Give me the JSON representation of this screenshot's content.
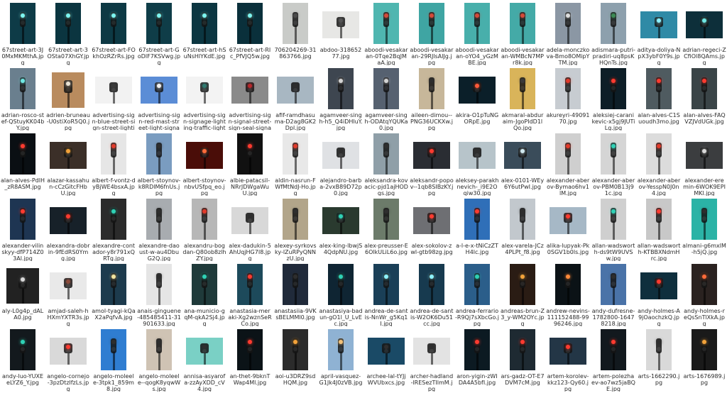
{
  "files": [
    {
      "name": "67street-art-3J0MxMKMthA.jpg",
      "bg": "#0e3b47",
      "lamp": "#7df5f0",
      "shape": "portrait"
    },
    {
      "name": "67street-art-3OSta07XhGY.jpg",
      "bg": "#0b3540",
      "lamp": "#7df5f0",
      "shape": "portrait"
    },
    {
      "name": "67street-art-FOkhOzRZrRs.jpg",
      "bg": "#0d3944",
      "lamp": "#7df5f0",
      "shape": "portrait"
    },
    {
      "name": "67street-art-GoDlF7KSVwg.jpg",
      "bg": "#0f3d48",
      "lamp": "#7df5f0",
      "shape": "portrait"
    },
    {
      "name": "67street-art-hSuNsHlYKdE.jpg",
      "bg": "#0c3641",
      "lamp": "#7df5f0",
      "shape": "portrait"
    },
    {
      "name": "67street-art-RIc_PfVJQ5w.jpg",
      "bg": "#0a303b",
      "lamp": "#7df5f0",
      "shape": "portrait"
    },
    {
      "name": "706204269-31863766.jpg",
      "bg": "#c9cbc8",
      "lamp": "#4a4a4a",
      "shape": "portrait"
    },
    {
      "name": "abdoo-31865277.jpg",
      "bg": "#e7e7e5",
      "lamp": "#555555",
      "shape": "landscape"
    },
    {
      "name": "aboodi-vesakaran-0Tqe2BqJMaA.jpg",
      "bg": "#4fb6b0",
      "lamp": "#d34a3a",
      "shape": "portrait"
    },
    {
      "name": "aboodi-vesakaran-29RJlsAlJg.jpg",
      "bg": "#3fa5a3",
      "lamp": "#d34a3a",
      "shape": "portrait"
    },
    {
      "name": "aboodi-vesakaran-oYO4_yGzMBE.jpg",
      "bg": "#48afab",
      "lamp": "#d34a3a",
      "shape": "portrait"
    },
    {
      "name": "aboodi-vesakaran-WMBcN7MPr8k.jpg",
      "bg": "#44aaa7",
      "lamp": "#d34a3a",
      "shape": "portrait"
    },
    {
      "name": "adela-monczkova-Bmo8OMipYTM.jpg",
      "bg": "#8b97a4",
      "lamp": "#dddddd",
      "shape": "portrait"
    },
    {
      "name": "adismara-putri-pradiri-uq8psKHQnTs.jpg",
      "bg": "#8da0ad",
      "lamp": "#3c8a54",
      "shape": "portrait"
    },
    {
      "name": "aditya-doliya-NpX3ybF0Y9s.jpg",
      "bg": "#2f8aa6",
      "lamp": "#8ef2ff",
      "shape": "landscape"
    },
    {
      "name": "adrian-regeci-ZCfiOl8QAms.jpg",
      "bg": "#0d2f3a",
      "lamp": "#6fe8e3",
      "shape": "landscape"
    },
    {
      "name": "adrian-rosco-stef-QStuyKK04bY.jpg",
      "bg": "#6a7f8e",
      "lamp": "#6fe8e3",
      "shape": "portrait"
    },
    {
      "name": "adrien-bruneau-U0stiXoR5Q0.jpg",
      "bg": "#b98b5e",
      "lamp": "#e9e2d4",
      "shape": "square"
    },
    {
      "name": "advertising-sign-blue-street-sign-street-lighting-102726.jpg",
      "bg": "#f2f2f2",
      "lamp": "#3a3a3a",
      "shape": "landscape"
    },
    {
      "name": "advertising-sign-red-mast-street-light-signage-742999.jpg",
      "bg": "#5b8dd6",
      "lamp": "#f2f2f2",
      "shape": "landscape"
    },
    {
      "name": "advertising-sign-signage-lighting-traffic-light-brand-100956.jpg",
      "bg": "#f3f3f3",
      "lamp": "#2f7a70",
      "shape": "landscape"
    },
    {
      "name": "advertising-sign-signal-street-sign-seal-signage-163696.jpg",
      "bg": "#8a8a8a",
      "lamp": "#b8272b",
      "shape": "landscape"
    },
    {
      "name": "afif-ramdhasuma-D2ag8GK2Dpl.jpg",
      "bg": "#a8b7c2",
      "lamp": "#2e2e2e",
      "shape": "landscape"
    },
    {
      "name": "agamveer-singh-h5_Q4iDHluY.jpg",
      "bg": "#3e4650",
      "lamp": "#d4d4d4",
      "shape": "portrait"
    },
    {
      "name": "agamveer-singh-ODAtqYQUKa0.jpg",
      "bg": "#566170",
      "lamp": "#d4d4d4",
      "shape": "portrait"
    },
    {
      "name": "aileen-dimou--PNG36UCKXw.jpg",
      "bg": "#c7b79a",
      "lamp": "#2e2e2e",
      "shape": "portrait"
    },
    {
      "name": "akira-O1pTuNGORpE.jpg",
      "bg": "#0b1f29",
      "lamp": "#ff5a3a",
      "shape": "landscape"
    },
    {
      "name": "akmaral-abduraim-JgoPIdD1lQo.jpg",
      "bg": "#d9b45a",
      "lamp": "#3a3a3a",
      "shape": "portrait"
    },
    {
      "name": "akureyri-4909170.jpg",
      "bg": "#c7ccd1",
      "lamp": "#e23a2a",
      "shape": "portrait"
    },
    {
      "name": "aleksiej-caranikevic-x5gj9JUTiLg.jpg",
      "bg": "#0d1e27",
      "lamp": "#ff3b30",
      "shape": "portrait"
    },
    {
      "name": "alan-alves-C1Suoudh3mo.jpg",
      "bg": "#4f5b60",
      "lamp": "#ff3b30",
      "shape": "portrait"
    },
    {
      "name": "alan-alves-FAQVZJVdUGk.jpg",
      "bg": "#3a4447",
      "lamp": "#ff3b30",
      "shape": "portrait"
    },
    {
      "name": "alan-alves-PdlH_zR8ASM.jpg",
      "bg": "#0a0f13",
      "lamp": "#ff3b30",
      "shape": "portrait"
    },
    {
      "name": "alazar-kassahun-cCzGitcFHbU.jpg",
      "bg": "#3b2f28",
      "lamp": "#f2a23a",
      "shape": "landscape"
    },
    {
      "name": "albert-f-vontz-dyBjWE4bsxA.jpg",
      "bg": "#e6e6e6",
      "lamp": "#e23a2a",
      "shape": "portrait"
    },
    {
      "name": "albert-stoynov-k8RDlM6fnUs.jpg",
      "bg": "#7a9cc0",
      "lamp": "#2e2e2e",
      "shape": "portrait"
    },
    {
      "name": "albert-stoynov-nbvUSfpq_eo.jpg",
      "bg": "#4a0d08",
      "lamp": "#ff6b3a",
      "shape": "landscape"
    },
    {
      "name": "albie-patacsil-NRrJDWgaWuU.jpg",
      "bg": "#111111",
      "lamp": "#ff3b30",
      "shape": "portrait"
    },
    {
      "name": "aldin-nasrun-FWfMtNdJ-Ho.jpg",
      "bg": "#e8e8e8",
      "lamp": "#e23a2a",
      "shape": "portrait"
    },
    {
      "name": "alejandro-barba-2vxB89D72p0.jpg",
      "bg": "#dfe1e4",
      "lamp": "#2e2e2e",
      "shape": "landscape"
    },
    {
      "name": "aleksandra-kovacic-pjd1ajHODgs.jpg",
      "bg": "#8f9fa8",
      "lamp": "#2e2e2e",
      "shape": "portrait"
    },
    {
      "name": "aleksandr-popov--1qb8SIBzKY.jpg",
      "bg": "#2a2d33",
      "lamp": "#ff3b30",
      "shape": "landscape"
    },
    {
      "name": "aleksey-parakhnevich-_i9E2Oqiw30.jpg",
      "bg": "#b7c4ca",
      "lamp": "#2e2e2e",
      "shape": "landscape"
    },
    {
      "name": "alex-0101-WEy6Y6utPwI.jpg",
      "bg": "#3a4c5a",
      "lamp": "#cfe8ef",
      "shape": "landscape"
    },
    {
      "name": "alexander-aberov-Bymao6hv1lM.jpg",
      "bg": "#cfcfcf",
      "lamp": "#e23a2a",
      "shape": "portrait"
    },
    {
      "name": "alexander-aberov-PBM0B13j91c.jpg",
      "bg": "#d5d5d5",
      "lamp": "#2fd1b5",
      "shape": "portrait"
    },
    {
      "name": "alexander-aberov-YesspN0J0n4.jpg",
      "bg": "#dcdcdc",
      "lamp": "#e23a2a",
      "shape": "portrait"
    },
    {
      "name": "alexander-eremin-6WOK9EPIMKl.jpg",
      "bg": "#3b3d3f",
      "lamp": "#d9d9d9",
      "shape": "landscape"
    },
    {
      "name": "alexander-vilinskyy-dfP714Z03Al.jpg",
      "bg": "#1e3552",
      "lamp": "#ff3b30",
      "shape": "portrait"
    },
    {
      "name": "alexandra-dobrin-9fEdRS0Ymg.jpg",
      "bg": "#172129",
      "lamp": "#ff3b30",
      "shape": "landscape"
    },
    {
      "name": "alexandre-contador-y8r791xQRTg.jpg",
      "bg": "#2b2b2b",
      "lamp": "#2fd1b5",
      "shape": "portrait"
    },
    {
      "name": "alexandre-daoust-w-au4DbuG2Q.jpg",
      "bg": "#a8acb0",
      "lamp": "#2e2e2e",
      "shape": "portrait"
    },
    {
      "name": "alexandru-bogdan-Q80ob8zlhZY.jpg",
      "bg": "#b7b7b7",
      "lamp": "#e23a2a",
      "shape": "portrait"
    },
    {
      "name": "alex-dadukin-5AhUqjHG7I8.jpg",
      "bg": "#d8d8d8",
      "lamp": "#2e2e2e",
      "shape": "landscape"
    },
    {
      "name": "alexey-syrkovsky-lZuRPyQNNzU.jpg",
      "bg": "#b2a58a",
      "lamp": "#2e2e2e",
      "shape": "portrait"
    },
    {
      "name": "alex-king-lbwjS4QdpNU.jpg",
      "bg": "#2a3a2f",
      "lamp": "#2fd1b5",
      "shape": "landscape"
    },
    {
      "name": "alex-preusser-E6OlkULiL6o.jpg",
      "bg": "#6c7b6a",
      "lamp": "#2e2e2e",
      "shape": "portrait"
    },
    {
      "name": "alex-sokolov-zwl-gtb98zg.jpg",
      "bg": "#6e6f73",
      "lamp": "#ff3b30",
      "shape": "landscape"
    },
    {
      "name": "a-l-e-x-tNiCzZTH4lc.jpg",
      "bg": "#2f6fb8",
      "lamp": "#ff3b30",
      "shape": "portrait"
    },
    {
      "name": "alex-varela-JCz4PLPt_f8.jpg",
      "bg": "#c2c8cd",
      "lamp": "#2e2e2e",
      "shape": "portrait"
    },
    {
      "name": "alika-lupyak-Pk0SGV1b0ls.jpg",
      "bg": "#a6b8c6",
      "lamp": "#ff3b30",
      "shape": "landscape"
    },
    {
      "name": "allan-wadsworth-ds9tW9UVSw.jpg",
      "bg": "#cfcfcf",
      "lamp": "#2fd1b5",
      "shape": "portrait"
    },
    {
      "name": "allan-wadsworth-KTBBXNdmHrc.jpg",
      "bg": "#c8c8c8",
      "lamp": "#ff3b30",
      "shape": "portrait"
    },
    {
      "name": "almani-g6mxlM-h5jQ.jpg",
      "bg": "#2bb3a6",
      "lamp": "#2e2e2e",
      "shape": "portrait"
    },
    {
      "name": "aly-L0g4p_dALA0.jpg",
      "bg": "#222222",
      "lamp": "#d9d9d9",
      "shape": "square"
    },
    {
      "name": "amjad-saleh-hHXmYXTR3s.jpg",
      "bg": "#e9e9e9",
      "lamp": "#8a4a3a",
      "shape": "landscape"
    },
    {
      "name": "amol-tyagi-kQaX2aPqfvA.jpg",
      "bg": "#1d3b4d",
      "lamp": "#f2e4a0",
      "shape": "portrait"
    },
    {
      "name": "anais-ginguene-485485411-31901633.jpg",
      "bg": "#e5e5e5",
      "lamp": "#2e2e2e",
      "shape": "portrait"
    },
    {
      "name": "ana-municio-gqM-qkA2Sj4.jpg",
      "bg": "#1f3a3a",
      "lamp": "#2fd1b5",
      "shape": "portrait"
    },
    {
      "name": "anastasia-meraki-Xg2wznSeRCo.jpg",
      "bg": "#1d4a5b",
      "lamp": "#ff3b30",
      "shape": "portrait"
    },
    {
      "name": "anastasiia-9VKsBELMMl0.jpg",
      "bg": "#202a3a",
      "lamp": "#2e2e2e",
      "shape": "portrait"
    },
    {
      "name": "anastasiya-badun-gO1l_U_LvEc.jpg",
      "bg": "#0f2533",
      "lamp": "#2fd1b5",
      "shape": "portrait"
    },
    {
      "name": "andrea-de-santis-NnWr_g5Kq1I.jpg",
      "bg": "#1a3f57",
      "lamp": "#8ef2ff",
      "shape": "portrait"
    },
    {
      "name": "andrea-de-santis-W2OK6Du51cc.jpg",
      "bg": "#173a4f",
      "lamp": "#8ef2ff",
      "shape": "portrait"
    },
    {
      "name": "andrea-ferrario-R9Qj7sXbcGo.jpg",
      "bg": "#2b5e8a",
      "lamp": "#2fd1b5",
      "shape": "portrait"
    },
    {
      "name": "andreas-brun-Z3_y-WM2OYc.jpg",
      "bg": "#2a1c14",
      "lamp": "#f2a23a",
      "shape": "portrait"
    },
    {
      "name": "andrew-nevins-111152488-9996246.jpg",
      "bg": "#0b1216",
      "lamp": "#ff8a3a",
      "shape": "portrait"
    },
    {
      "name": "andy-dufresne-1782800-16478218.jpg",
      "bg": "#4a73a8",
      "lamp": "#2e2e2e",
      "shape": "portrait"
    },
    {
      "name": "andy-holmes-A9jOaochzkQ.jpg",
      "bg": "#0f2f3d",
      "lamp": "#ff3b30",
      "shape": "landscape"
    },
    {
      "name": "andy-holmes-reQsSnTlXkA.jpg",
      "bg": "#2a2220",
      "lamp": "#ff6b3a",
      "shape": "portrait"
    },
    {
      "name": "andy-luo-YUXEeLYZ6_Y.jpg",
      "bg": "#13191d",
      "lamp": "#2fd1b5",
      "shape": "portrait"
    },
    {
      "name": "angelo-cornejo-3pzDtzlfzLs.jpg",
      "bg": "#d9d9d9",
      "lamp": "#ff3b30",
      "shape": "landscape"
    },
    {
      "name": "angelo-moleele-3tpk1_859m8.jpg",
      "bg": "#2f7dd1",
      "lamp": "#2e2e2e",
      "shape": "portrait"
    },
    {
      "name": "angelo-moleele--qogK8yqwWs.jpg",
      "bg": "#cfc3b4",
      "lamp": "#2e2e2e",
      "shape": "portrait"
    },
    {
      "name": "annisa-asyarofa-zzAyXDD_cV4.jpg",
      "bg": "#7ad0c5",
      "lamp": "#2e2e2e",
      "shape": "landscape"
    },
    {
      "name": "an-thet-9bknTWap4Ml.jpg",
      "bg": "#0b1317",
      "lamp": "#ff3b30",
      "shape": "portrait"
    },
    {
      "name": "aoi-u3DRZ9sdHQM.jpg",
      "bg": "#2b2b2b",
      "lamp": "#f2a23a",
      "shape": "portrait"
    },
    {
      "name": "april-vasquez-G1Jk4J0zVB.jpg",
      "bg": "#8fb2d3",
      "lamp": "#f2c17a",
      "shape": "portrait"
    },
    {
      "name": "archee-lal-tYJjWVUbxcs.jpg",
      "bg": "#1a4a66",
      "lamp": "#2e2e2e",
      "shape": "landscape"
    },
    {
      "name": "archer-hadland-lRESezTIlmM.jpg",
      "bg": "#e3e3e3",
      "lamp": "#2e2e2e",
      "shape": "landscape"
    },
    {
      "name": "aron-yigin-zWIDA4A5bfI.jpg",
      "bg": "#0c1a22",
      "lamp": "#ff3b30",
      "shape": "portrait"
    },
    {
      "name": "ars-gadz-OT-E7DVM7cM.jpg",
      "bg": "#1e2a32",
      "lamp": "#ff3b30",
      "shape": "portrait"
    },
    {
      "name": "artem-korolev-kkz123-Qy60.jpg",
      "bg": "#233646",
      "lamp": "#ff3b30",
      "shape": "landscape"
    },
    {
      "name": "artem-polezhaev-ao7wz5jaBQE.jpg",
      "bg": "#12191e",
      "lamp": "#ff3b30",
      "shape": "portrait"
    },
    {
      "name": "arts-1662290.jpg",
      "bg": "#d9d9d9",
      "lamp": "#2e2e2e",
      "shape": "portrait"
    },
    {
      "name": "arts-1676989.jpg",
      "bg": "#1a1a1a",
      "lamp": "#f2a23a",
      "shape": "portrait"
    }
  ]
}
